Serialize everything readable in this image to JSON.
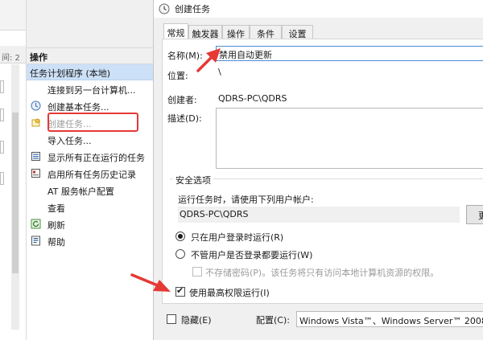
{
  "left_panel": {
    "column_fragment": "间: 2"
  },
  "actions": {
    "title": "操作",
    "selected": "任务计划程序 (本地)",
    "items": [
      {
        "label": "连接到另一台计算机...",
        "icon": "none",
        "disabled": false
      },
      {
        "label": "创建基本任务...",
        "icon": "wizard-icon",
        "disabled": false
      },
      {
        "label": "创建任务...",
        "icon": "task-icon",
        "disabled": true
      },
      {
        "label": "导入任务...",
        "icon": "none",
        "disabled": false
      },
      {
        "label": "显示所有正在运行的任务",
        "icon": "list-icon",
        "disabled": false
      },
      {
        "label": "启用所有任务历史记录",
        "icon": "history-icon",
        "disabled": false
      },
      {
        "label": "AT 服务帐户配置",
        "icon": "none",
        "disabled": false
      },
      {
        "label": "查看",
        "icon": "none",
        "disabled": false
      },
      {
        "label": "刷新",
        "icon": "refresh-icon",
        "disabled": false
      },
      {
        "label": "帮助",
        "icon": "help-icon",
        "disabled": false
      }
    ]
  },
  "dialog": {
    "title": "创建任务",
    "tabs": [
      "常规",
      "触发器",
      "操作",
      "条件",
      "设置"
    ],
    "general": {
      "name_label": "名称(M):",
      "name_value": "禁用自动更新",
      "location_label": "位置:",
      "location_value": "\\",
      "author_label": "创建者:",
      "author_value": "QDRS-PC\\QDRS",
      "description_label": "描述(D):",
      "description_value": ""
    },
    "security": {
      "title": "安全选项",
      "run_as_prompt": "运行任务时，请使用下列用户帐户:",
      "user_account": "QDRS-PC\\QDRS",
      "change_button_fragment": "更",
      "option_logged_on": "只在用户登录时运行(R)",
      "option_whether": "不管用户是否登录都要运行(W)",
      "no_store_password": "不存储密码(P)。该任务将只有访问本地计算机资源的权限。",
      "highest_privileges": "使用最高权限运行(I)",
      "selected_option": "只在用户登录时运行(R)",
      "highest_checked": true
    },
    "bottom": {
      "hidden_label": "隐藏(E)",
      "config_label": "配置(C):",
      "config_value": "Windows Vista™、Windows Server™ 2008"
    }
  },
  "colors": {
    "selection": "#cce0f7",
    "highlight_red": "#e53935"
  }
}
